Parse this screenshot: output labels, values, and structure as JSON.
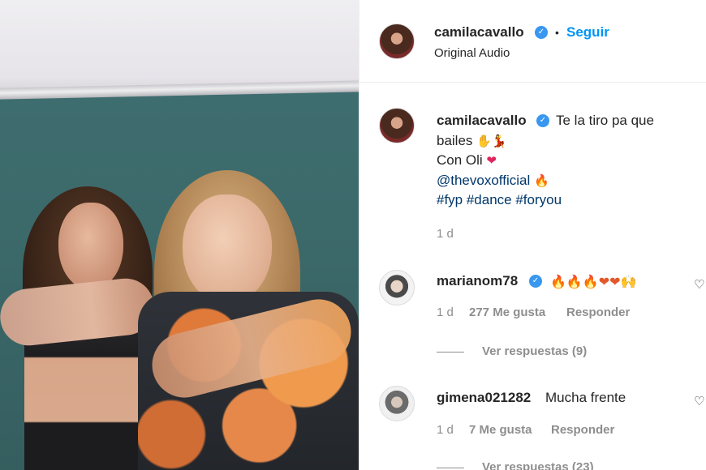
{
  "post": {
    "author": "camilacavallo",
    "follow_label": "Seguir",
    "separator": "•",
    "audio": "Original Audio"
  },
  "caption": {
    "author": "camilacavallo",
    "line1": "Te la tiro pa que",
    "line2": "bailes",
    "line2_emojis": "✋💃",
    "line3": "Con Oli",
    "line3_emoji": "❤",
    "mention": "@thevoxofficial",
    "mention_emoji": "🔥",
    "hashtags": "#fyp #dance #foryou",
    "time": "1 d"
  },
  "comments": [
    {
      "user": "marianom78",
      "text": "🔥🔥🔥❤❤🙌",
      "time": "1 d",
      "likes": "277 Me gusta",
      "reply_label": "Responder",
      "view_replies": "Ver respuestas (9)"
    },
    {
      "user": "gimena021282",
      "text": "Mucha frente",
      "time": "1 d",
      "likes": "7 Me gusta",
      "reply_label": "Responder",
      "view_replies": "Ver respuestas (23)"
    }
  ],
  "icons": {
    "verified": "verified-badge-icon",
    "like": "heart-outline-icon"
  },
  "colors": {
    "link_blue": "#0095f6",
    "verified_blue": "#3897f0",
    "muted_gray": "#8e8e8e"
  }
}
